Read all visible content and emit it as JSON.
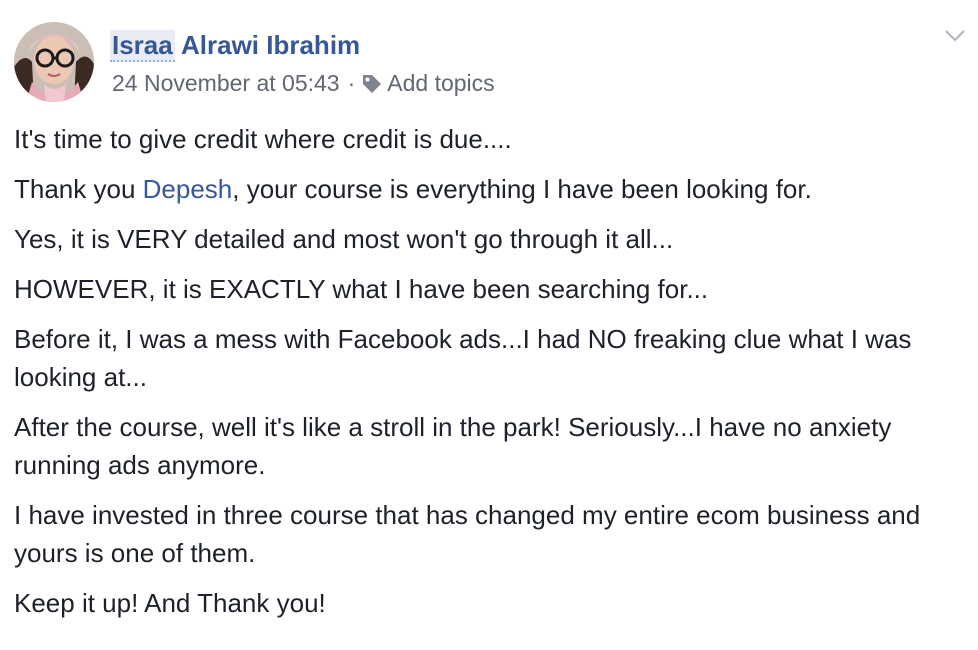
{
  "post": {
    "author_first": "Israa",
    "author_rest": "Alrawi Ibrahim",
    "timestamp": "24 November at 05:43",
    "separator": "·",
    "add_topics": "Add topics",
    "paragraphs": [
      {
        "text": "It's time to give credit where credit is due...."
      },
      {
        "before": "Thank you ",
        "mention": "Depesh",
        "after": ", your course is everything I have been looking for."
      },
      {
        "text": "Yes, it is VERY detailed and most won't go through it all..."
      },
      {
        "text": "HOWEVER, it is EXACTLY what I have been searching for..."
      },
      {
        "text": "Before it, I was a mess with Facebook ads...I had NO freaking clue what I was looking at..."
      },
      {
        "text": "After the course, well it's like a stroll in the park! Seriously...I have no anxiety running ads anymore."
      },
      {
        "text": "I have invested in three course that has changed my entire ecom business and yours is one of them."
      },
      {
        "text": "Keep it up! And Thank you!"
      }
    ]
  },
  "colors": {
    "link": "#365899",
    "text": "#1d2129",
    "meta": "#616770"
  },
  "icons": {
    "tag": "tag-icon",
    "menu": "chevron-down-icon"
  }
}
